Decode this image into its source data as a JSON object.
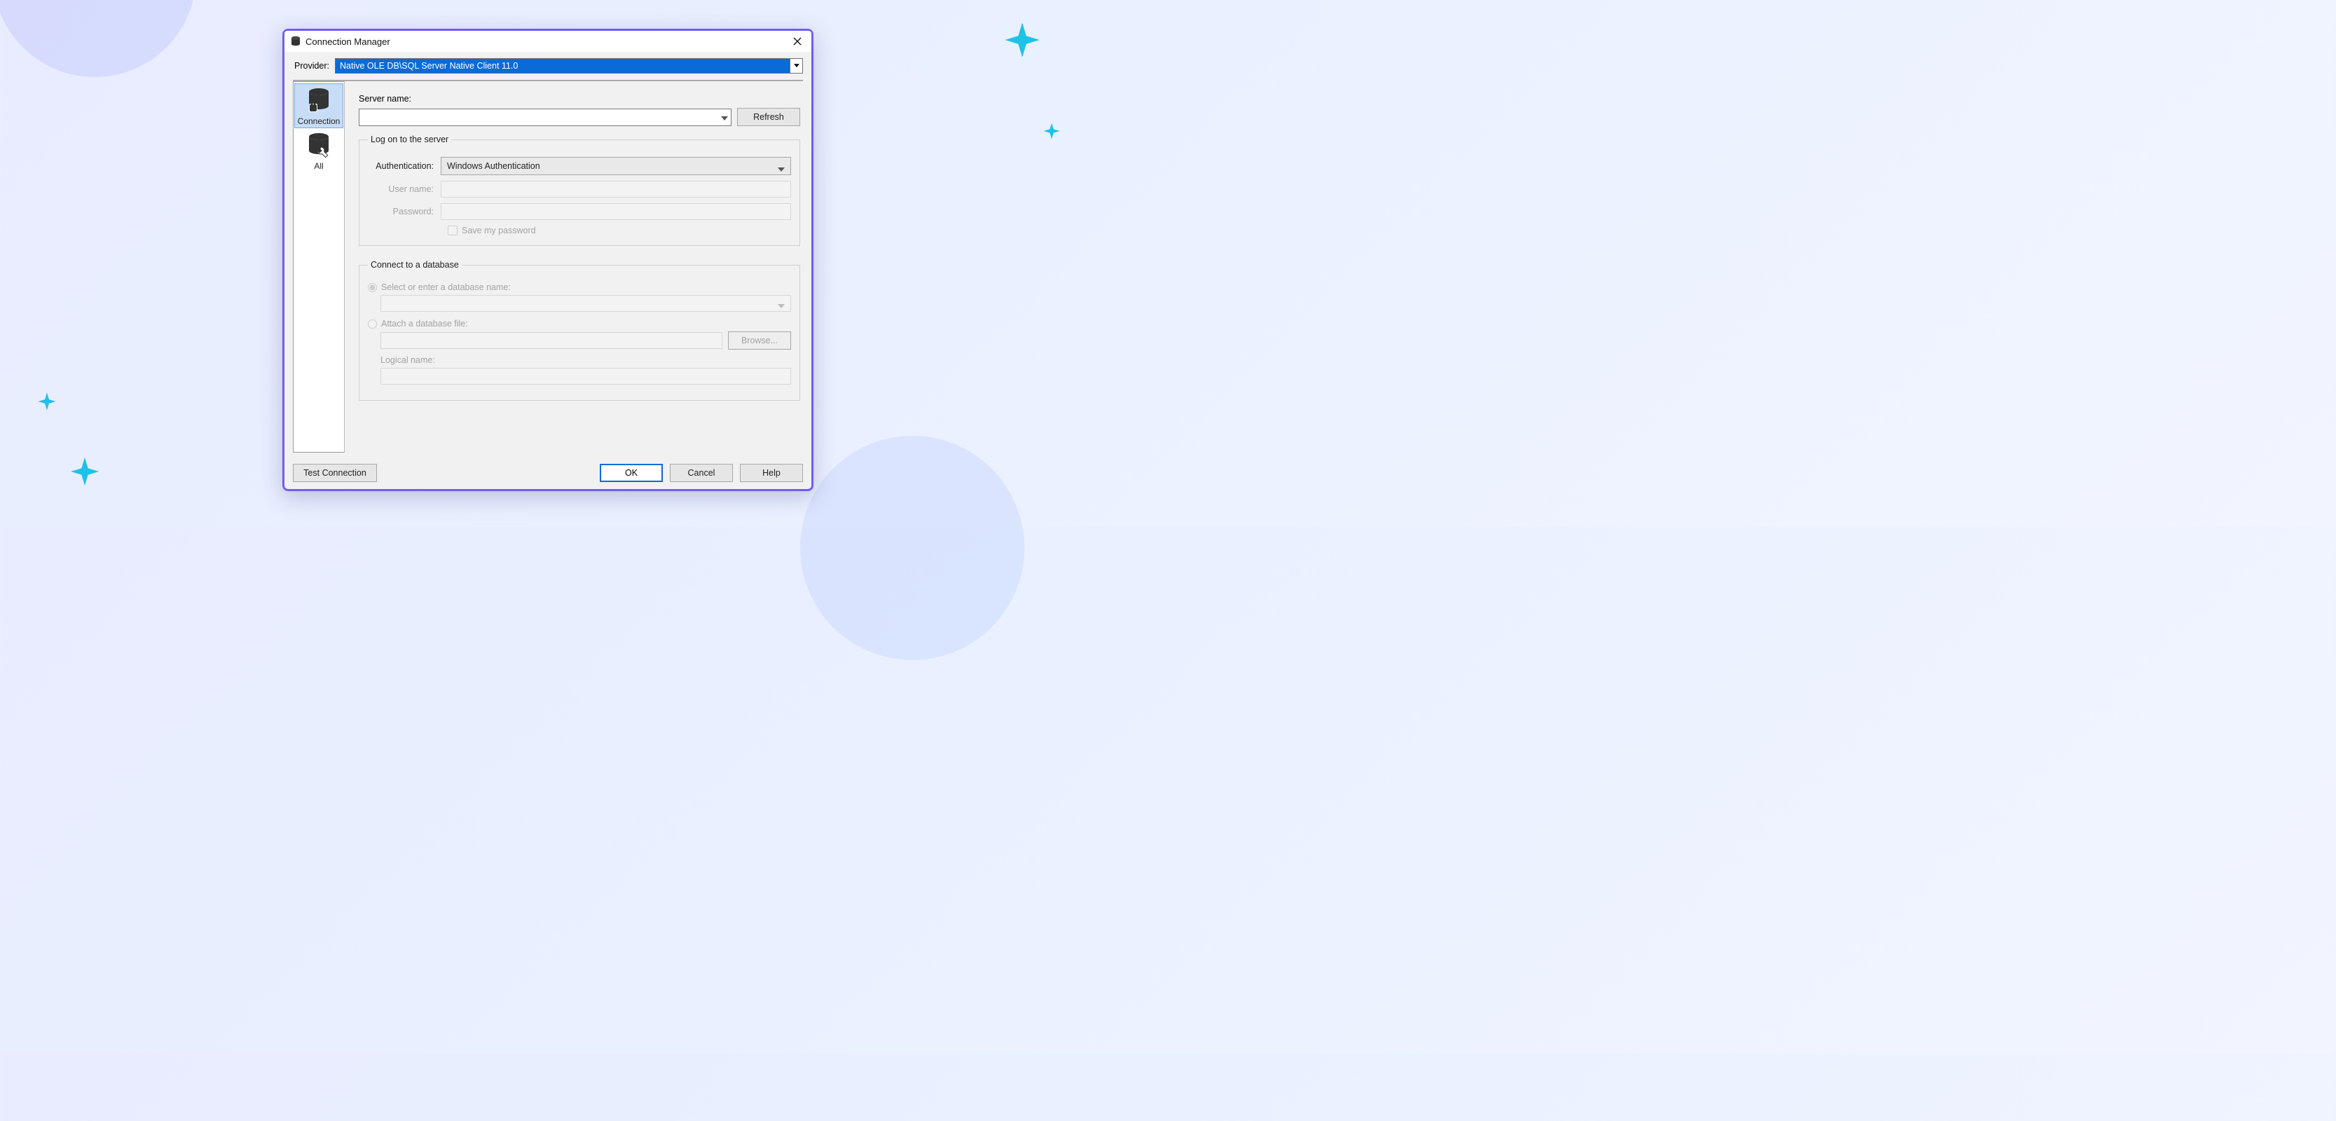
{
  "window": {
    "title": "Connection Manager"
  },
  "provider": {
    "label": "Provider:",
    "value": "Native OLE DB\\SQL Server Native Client 11.0"
  },
  "sidebar": {
    "items": [
      {
        "label": "Connection"
      },
      {
        "label": "All"
      }
    ]
  },
  "server": {
    "label": "Server name:",
    "value": "",
    "refresh": "Refresh"
  },
  "logon": {
    "legend": "Log on to the server",
    "auth_label": "Authentication:",
    "auth_value": "Windows Authentication",
    "user_label": "User name:",
    "password_label": "Password:",
    "save_pw_label": "Save my password"
  },
  "database": {
    "legend": "Connect to a database",
    "select_label": "Select or enter a database name:",
    "attach_label": "Attach a database file:",
    "browse": "Browse...",
    "logical_label": "Logical name:"
  },
  "footer": {
    "test": "Test Connection",
    "ok": "OK",
    "cancel": "Cancel",
    "help": "Help"
  }
}
